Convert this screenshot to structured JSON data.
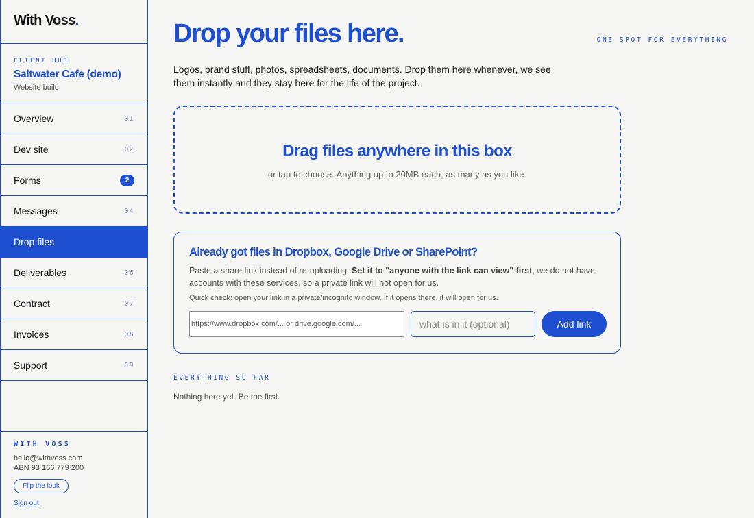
{
  "brand": {
    "name": "With Voss",
    "dot": "."
  },
  "client": {
    "kicker": "CLIENT HUB",
    "name": "Saltwater Cafe (demo)",
    "project": "Website build"
  },
  "nav": {
    "items": [
      {
        "label": "Overview",
        "num": "01"
      },
      {
        "label": "Dev site",
        "num": "02"
      },
      {
        "label": "Forms",
        "badge": "2"
      },
      {
        "label": "Messages",
        "num": "04"
      },
      {
        "label": "Drop files",
        "active": true
      },
      {
        "label": "Deliverables",
        "num": "06"
      },
      {
        "label": "Contract",
        "num": "07"
      },
      {
        "label": "Invoices",
        "num": "08"
      },
      {
        "label": "Support",
        "num": "09"
      }
    ]
  },
  "footer": {
    "kicker": "WITH VOSS",
    "email": "hello@withvoss.com",
    "abn": "ABN 93 166 779 200",
    "flip_label": "Flip the look",
    "signout_label": "Sign out"
  },
  "main": {
    "title": "Drop your files here.",
    "tagline": "ONE SPOT FOR EVERYTHING",
    "intro": "Logos, brand stuff, photos, spreadsheets, documents. Drop them here whenever, we see them instantly and they stay here for the life of the project.",
    "dropzone": {
      "title": "Drag files anywhere in this box",
      "subtitle": "or tap to choose. Anything up to 20MB each, as many as you like."
    },
    "link_box": {
      "title": "Already got files in Dropbox, Google Drive or SharePoint?",
      "text_before": "Paste a share link instead of re-uploading. ",
      "text_bold": "Set it to \"anyone with the link can view\" first",
      "text_after": ", we do not have accounts with these services, so a private link will not open for us.",
      "check": "Quick check: open your link in a private/incognito window. If it opens there, it will open for us.",
      "url_placeholder": "https://www.dropbox.com/... or drive.google.com/...",
      "desc_placeholder": "what is in it (optional)",
      "button_label": "Add link"
    },
    "so_far": {
      "kicker": "EVERYTHING SO FAR",
      "empty": "Nothing here yet. Be the first."
    }
  }
}
